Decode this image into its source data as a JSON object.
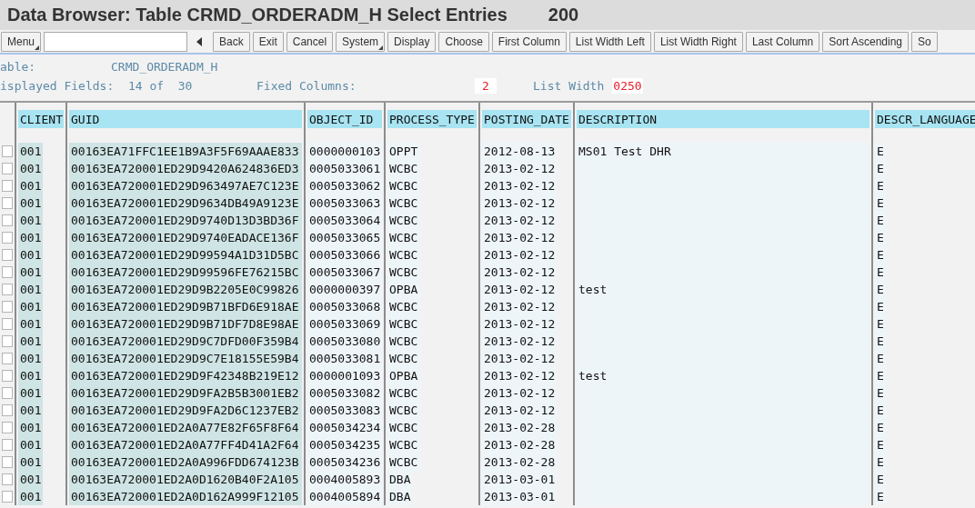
{
  "window": {
    "title": "Data Browser: Table CRMD_ORDERADM_H Select Entries",
    "count": "200"
  },
  "toolbar": {
    "items": [
      {
        "kind": "menu",
        "label": "Menu"
      },
      {
        "kind": "field",
        "value": ""
      },
      {
        "kind": "arrow"
      },
      {
        "kind": "button",
        "label": "Back"
      },
      {
        "kind": "button",
        "label": "Exit"
      },
      {
        "kind": "button",
        "label": "Cancel"
      },
      {
        "kind": "menu",
        "label": "System"
      },
      {
        "kind": "button",
        "label": "Display"
      },
      {
        "kind": "button",
        "label": "Choose"
      },
      {
        "kind": "button",
        "label": "First Column"
      },
      {
        "kind": "button",
        "label": "List Width Left"
      },
      {
        "kind": "button",
        "label": "List Width Right"
      },
      {
        "kind": "button",
        "label": "Last Column"
      },
      {
        "kind": "button",
        "label": "Sort Ascending"
      },
      {
        "kind": "button",
        "label": "So"
      }
    ]
  },
  "info": {
    "table_label": "able:",
    "table_value": "CRMD_ORDERADM_H",
    "fields_label": "isplayed Fields:",
    "fields_value": "14 of  30",
    "fixed_label": "Fixed Columns:",
    "fixed_value": "2",
    "width_label": "List Width",
    "width_value": "0250"
  },
  "table": {
    "columns": [
      {
        "label": "CLIENT",
        "key": true
      },
      {
        "label": "GUID",
        "key": true
      },
      {
        "label": "OBJECT_ID",
        "key": false
      },
      {
        "label": "PROCESS_TYPE",
        "key": false
      },
      {
        "label": "POSTING_DATE",
        "key": false
      },
      {
        "label": "DESCRIPTION",
        "key": false
      },
      {
        "label": "DESCR_LANGUAGE",
        "key": false
      }
    ],
    "rows": [
      {
        "selected": false,
        "cells": [
          "001",
          "00163EA71FFC1EE1B9A3F5F69AAAE833",
          "0000000103",
          "OPPT",
          "2012-08-13",
          "MS01 Test DHR",
          "E"
        ]
      },
      {
        "selected": false,
        "cells": [
          "001",
          "00163EA720001ED29D9420A624836ED3",
          "0005033061",
          "WCBC",
          "2013-02-12",
          "",
          "E"
        ]
      },
      {
        "selected": false,
        "cells": [
          "001",
          "00163EA720001ED29D963497AE7C123E",
          "0005033062",
          "WCBC",
          "2013-02-12",
          "",
          "E"
        ]
      },
      {
        "selected": false,
        "cells": [
          "001",
          "00163EA720001ED29D9634DB49A9123E",
          "0005033063",
          "WCBC",
          "2013-02-12",
          "",
          "E"
        ]
      },
      {
        "selected": false,
        "cells": [
          "001",
          "00163EA720001ED29D9740D13D3BD36F",
          "0005033064",
          "WCBC",
          "2013-02-12",
          "",
          "E"
        ]
      },
      {
        "selected": false,
        "cells": [
          "001",
          "00163EA720001ED29D9740EADACE136F",
          "0005033065",
          "WCBC",
          "2013-02-12",
          "",
          "E"
        ]
      },
      {
        "selected": false,
        "cells": [
          "001",
          "00163EA720001ED29D99594A1D31D5BC",
          "0005033066",
          "WCBC",
          "2013-02-12",
          "",
          "E"
        ]
      },
      {
        "selected": false,
        "cells": [
          "001",
          "00163EA720001ED29D99596FE76215BC",
          "0005033067",
          "WCBC",
          "2013-02-12",
          "",
          "E"
        ]
      },
      {
        "selected": false,
        "cells": [
          "001",
          "00163EA720001ED29D9B2205E0C99826",
          "0000000397",
          "OPBA",
          "2013-02-12",
          "test",
          "E"
        ]
      },
      {
        "selected": false,
        "cells": [
          "001",
          "00163EA720001ED29D9B71BFD6E918AE",
          "0005033068",
          "WCBC",
          "2013-02-12",
          "",
          "E"
        ]
      },
      {
        "selected": false,
        "cells": [
          "001",
          "00163EA720001ED29D9B71DF7D8E98AE",
          "0005033069",
          "WCBC",
          "2013-02-12",
          "",
          "E"
        ]
      },
      {
        "selected": false,
        "cells": [
          "001",
          "00163EA720001ED29D9C7DFD00F359B4",
          "0005033080",
          "WCBC",
          "2013-02-12",
          "",
          "E"
        ]
      },
      {
        "selected": false,
        "cells": [
          "001",
          "00163EA720001ED29D9C7E18155E59B4",
          "0005033081",
          "WCBC",
          "2013-02-12",
          "",
          "E"
        ]
      },
      {
        "selected": false,
        "cells": [
          "001",
          "00163EA720001ED29D9F42348B219E12",
          "0000001093",
          "OPBA",
          "2013-02-12",
          "test",
          "E"
        ]
      },
      {
        "selected": false,
        "cells": [
          "001",
          "00163EA720001ED29D9FA2B5B3001EB2",
          "0005033082",
          "WCBC",
          "2013-02-12",
          "",
          "E"
        ]
      },
      {
        "selected": false,
        "cells": [
          "001",
          "00163EA720001ED29D9FA2D6C1237EB2",
          "0005033083",
          "WCBC",
          "2013-02-12",
          "",
          "E"
        ]
      },
      {
        "selected": false,
        "cells": [
          "001",
          "00163EA720001ED2A0A77E82F65F8F64",
          "0005034234",
          "WCBC",
          "2013-02-28",
          "",
          "E"
        ]
      },
      {
        "selected": false,
        "cells": [
          "001",
          "00163EA720001ED2A0A77FF4D41A2F64",
          "0005034235",
          "WCBC",
          "2013-02-28",
          "",
          "E"
        ]
      },
      {
        "selected": false,
        "cells": [
          "001",
          "00163EA720001ED2A0A996FDD674123B",
          "0005034236",
          "WCBC",
          "2013-02-28",
          "",
          "E"
        ]
      },
      {
        "selected": false,
        "cells": [
          "001",
          "00163EA720001ED2A0D1620B40F2A105",
          "0004005893",
          "DBA",
          "2013-03-01",
          "",
          "E"
        ]
      },
      {
        "selected": false,
        "cells": [
          "001",
          "00163EA720001ED2A0D162A999F12105",
          "0004005894",
          "DBA",
          "2013-03-01",
          "",
          "E"
        ]
      }
    ]
  }
}
